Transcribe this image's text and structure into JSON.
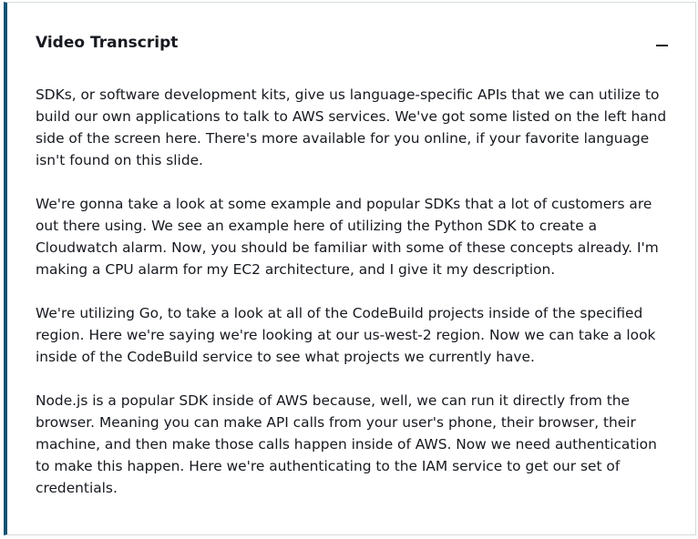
{
  "transcript": {
    "title": "Video Transcript",
    "collapse_icon": "minus-icon",
    "paragraphs": [
      "SDKs, or software development kits, give us language-specific APIs that we can utilize to build our own applications to talk to AWS services. We've got some listed on the left hand side of the screen here. There's more available for you online, if your favorite language isn't found on this slide.",
      "We're gonna take a look at some example and popular SDKs that a lot of customers are out there using. We see an example here of utilizing the Python SDK to create a Cloudwatch alarm. Now, you should be familiar with some of these concepts already. I'm making a CPU alarm for my EC2 architecture, and I give it my description.",
      "We're utilizing Go, to take a look at all of the CodeBuild projects inside of the specified region. Here we're saying we're looking at our us-west-2 region. Now we can take a look inside of the CodeBuild service to see what projects we currently have.",
      "Node.js is a popular SDK inside of AWS because, well, we can run it directly from the browser. Meaning you can make API calls from your user's phone, their browser, their machine, and then make those calls happen inside of AWS. Now we need authentication to make this happen. Here we're authenticating to the IAM service to get our set of credentials."
    ]
  },
  "colors": {
    "accent_border": "#0f5373",
    "text": "#16191f",
    "panel_border": "#d5dbdb"
  }
}
